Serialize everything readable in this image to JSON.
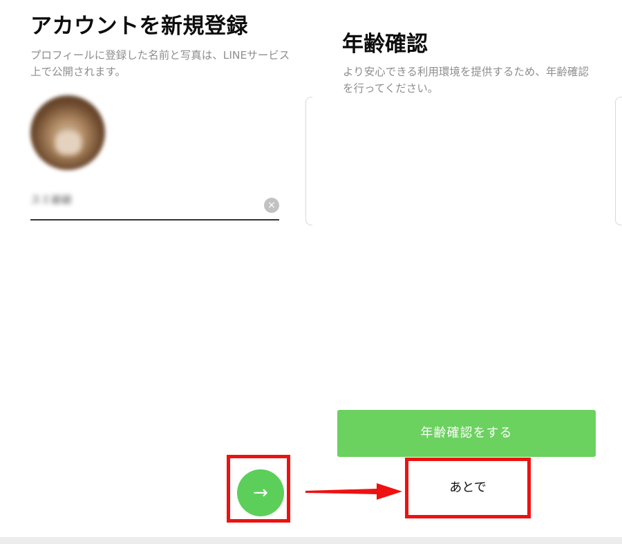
{
  "left_panel": {
    "title": "アカウントを新規登録",
    "description": "プロフィールに登録した名前と写真は、LINEサービス上で公開されます。",
    "name_value": "スミ爺爺"
  },
  "right_panel": {
    "title": "年齢確認",
    "description": "より安心できる利用環境を提供するため、年齢確認を行ってください。",
    "verify_button_label": "年齢確認をする",
    "later_button_label": "あとで"
  },
  "colors": {
    "accent_green": "#5ccf5a",
    "highlight_red": "#ee1111"
  },
  "icons": {
    "clear": "×",
    "next_arrow": "→"
  }
}
